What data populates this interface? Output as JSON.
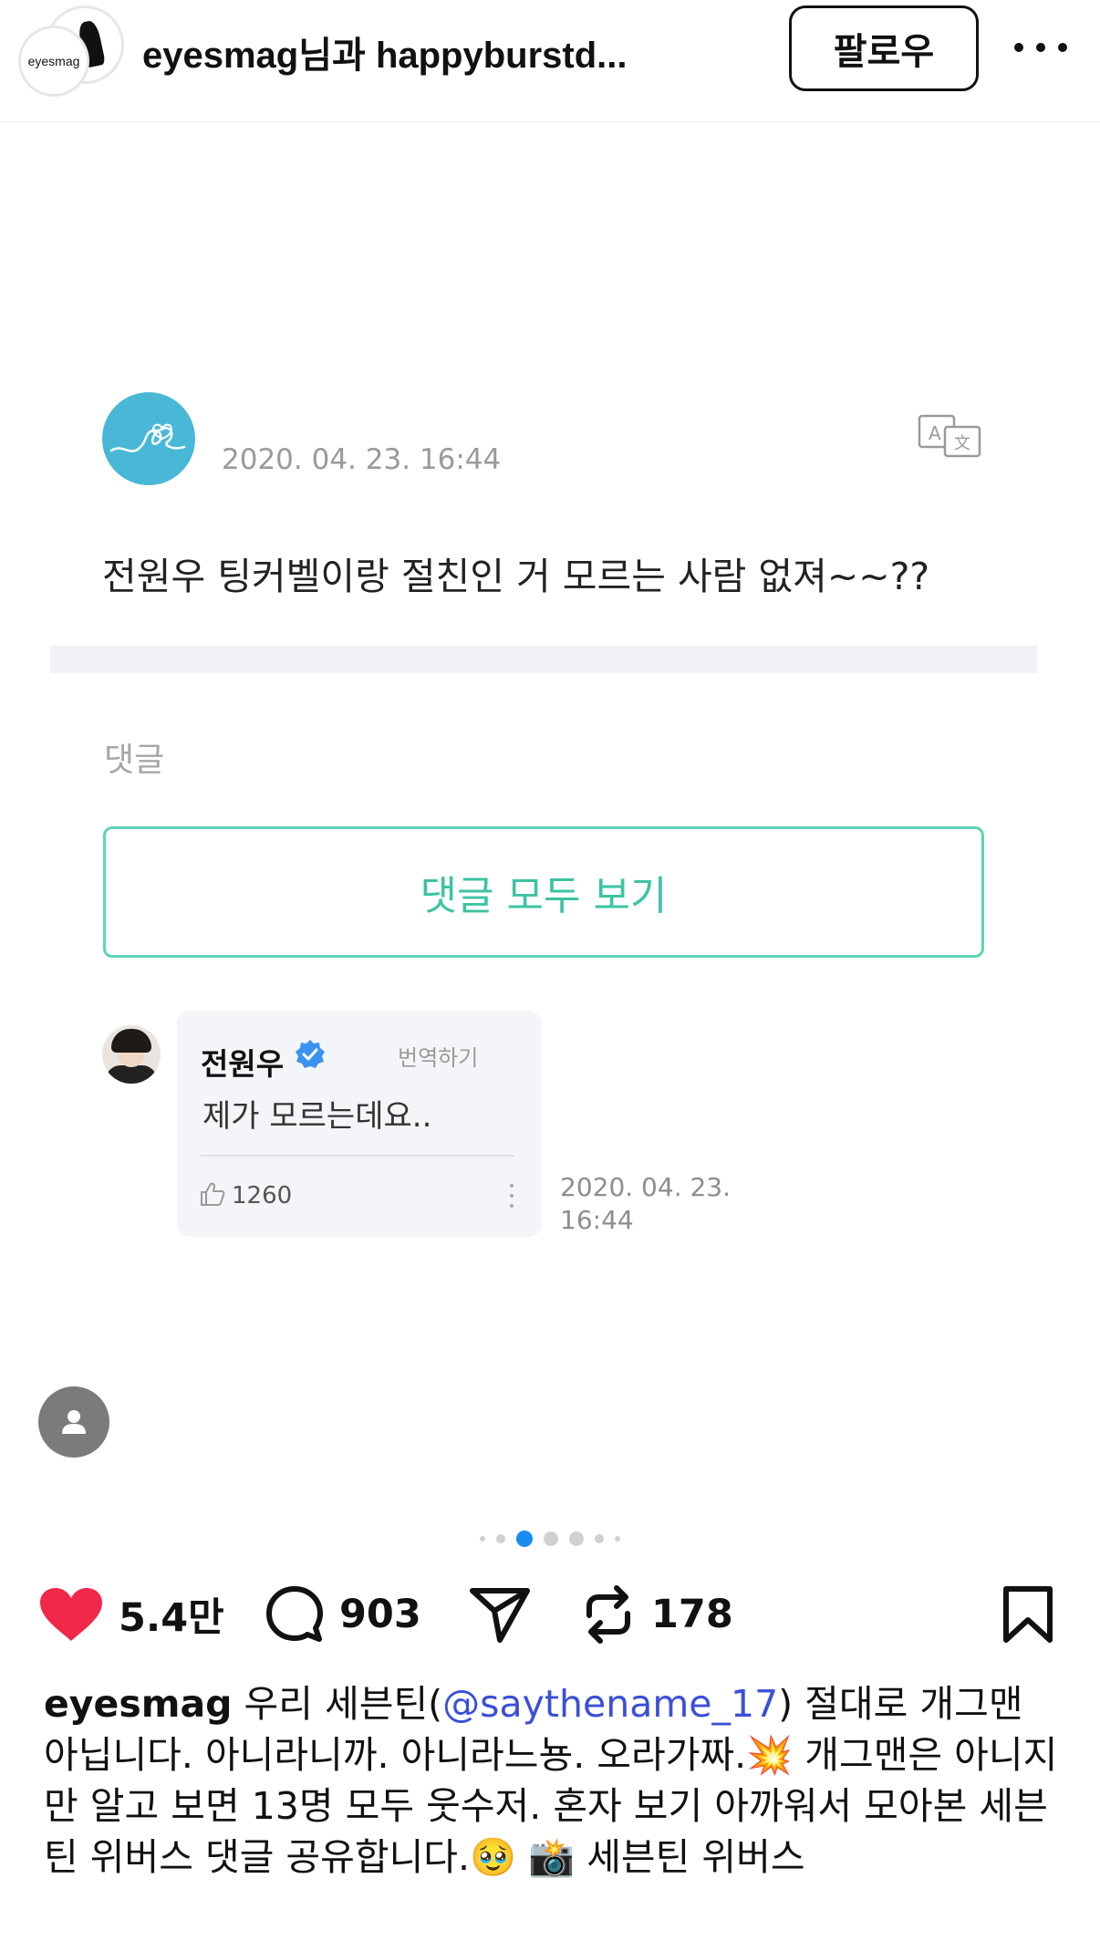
{
  "header": {
    "title": "eyesmag님과 happyburstd...",
    "avatar_text": "eyesmag",
    "follow_label": "팔로우"
  },
  "post": {
    "weverse_post": {
      "date": "2020. 04. 23. 16:44",
      "text": "전원우 팅커벨이랑 절친인 거 모르는 사람 없져~~??",
      "comment_label": "댓글",
      "view_all_label": "댓글 모두 보기"
    },
    "reply": {
      "name": "전원우",
      "translate_label": "번역하기",
      "text": "제가 모르는데요..",
      "likes": "1260",
      "date_line1": "2020. 04. 23.",
      "date_line2": "16:44"
    },
    "carousel": {
      "total": 7,
      "active_index": 2
    }
  },
  "actions": {
    "likes": "5.4만",
    "comments": "903",
    "reposts": "178"
  },
  "caption": {
    "username": "eyesmag",
    "text_1": "우리 세븐틴(",
    "mention": "@saythename_17",
    "text_2": ") 절대로 개그맨 아닙니다. 아니라니까. 아니라느뇽. 오라가짜.💥 개그맨은 아니지만 알고 보면 13명 모두 웃수저. 혼자 보기 아까워서 모아본 세븐틴 위버스 댓글 공유합니다.🥹 📸 세븐틴 위버스"
  },
  "colors": {
    "accent_teal": "#3cc3a3",
    "like_red": "#f02849",
    "active_dot": "#1a8cf0",
    "mention_blue": "#3b4fd8"
  }
}
